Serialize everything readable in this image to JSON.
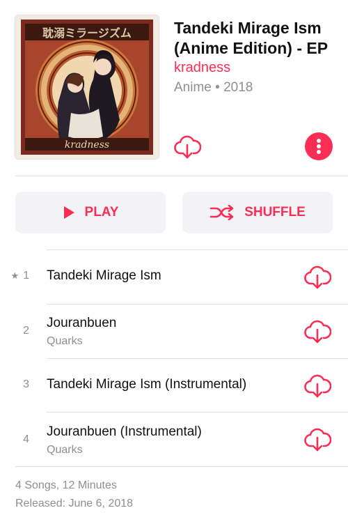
{
  "album": {
    "title": "Tandeki Mirage Ism (Anime Edition) - EP",
    "artist": "kradness",
    "meta": "Anime • 2018",
    "cover_text": "kradness"
  },
  "actions": {
    "play_label": "PLAY",
    "shuffle_label": "SHUFFLE"
  },
  "tracks": [
    {
      "number": "1",
      "starred": true,
      "title": "Tandeki Mirage Ism",
      "artist": ""
    },
    {
      "number": "2",
      "starred": false,
      "title": "Jouranbuen",
      "artist": "Quarks"
    },
    {
      "number": "3",
      "starred": false,
      "title": "Tandeki Mirage Ism (Instrumental)",
      "artist": ""
    },
    {
      "number": "4",
      "starred": false,
      "title": "Jouranbuen (Instrumental)",
      "artist": "Quarks"
    }
  ],
  "footer": {
    "summary": "4 Songs, 12 Minutes",
    "released": "Released: June 6, 2018"
  },
  "colors": {
    "accent": "#fa2d55",
    "secondary_text": "#8e8e93",
    "button_bg": "#f3f3f7"
  },
  "icons": {
    "download": "cloud-download-icon",
    "more": "more-vertical-icon",
    "play": "play-icon",
    "shuffle": "shuffle-icon",
    "star": "star-icon"
  }
}
